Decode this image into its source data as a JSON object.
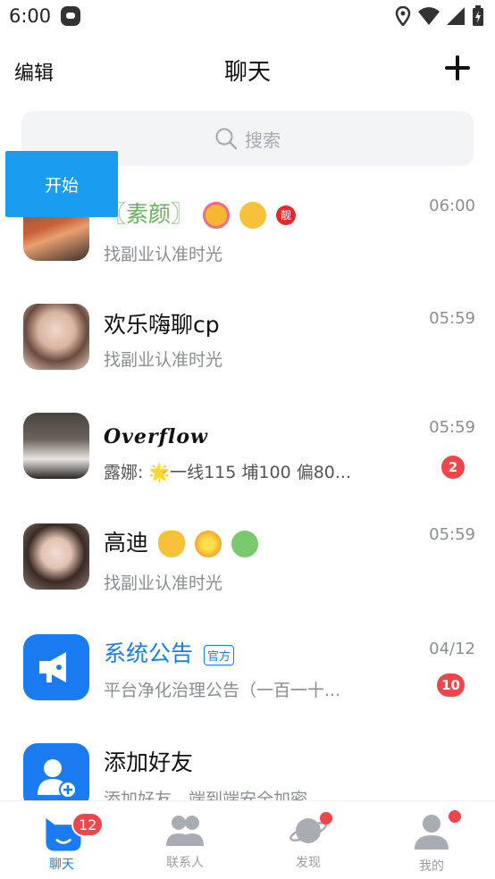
{
  "status_bar": {
    "time": "6:00",
    "icons": [
      "android-app-icon",
      "location-icon",
      "wifi-icon",
      "signal-icon",
      "battery-icon"
    ]
  },
  "header": {
    "edit_label": "编辑",
    "title": "聊天",
    "add_icon": "plus-icon"
  },
  "search": {
    "placeholder": "搜索",
    "icon": "search-icon"
  },
  "start_button": {
    "label": "开始"
  },
  "chats": [
    {
      "name": "〖素颜〗",
      "emojis": [
        "smiling-face-with-hearts-emoji",
        "zany-face-emoji"
      ],
      "badge": "靓",
      "preview": "找副业认准时光",
      "time": "06:00",
      "unread": ""
    },
    {
      "name": "欢乐嗨聊cp",
      "preview": "找副业认准时光",
      "time": "05:59",
      "unread": ""
    },
    {
      "name": "Overflow",
      "preview": "露娜: 🌟一线115 埔100 偏80...",
      "time": "05:59",
      "unread": "2"
    },
    {
      "name": "高迪",
      "emojis": [
        "waving-hand-emoji",
        "sparkle-emoji",
        "nauseated-face-emoji"
      ],
      "preview": "找副业认准时光",
      "time": "05:59",
      "unread": ""
    },
    {
      "name": "系统公告",
      "tag": "官方",
      "preview": "平台净化治理公告（一百一十...",
      "time": "04/12",
      "unread": "10"
    },
    {
      "name": "添加好友",
      "preview": "添加好友，端到端安全加密",
      "time": "",
      "unread": ""
    }
  ],
  "colors": {
    "accent_blue": "#1a7cf0",
    "badge_red": "#f0464b",
    "start_button": "#1a9cf0",
    "green_name": "#6ab05e"
  },
  "bottom_nav": {
    "items": [
      {
        "label": "聊天",
        "icon": "chat-cat-icon",
        "badge": "12",
        "active": true
      },
      {
        "label": "联系人",
        "icon": "contacts-icon",
        "badge": "",
        "active": false
      },
      {
        "label": "发现",
        "icon": "planet-icon",
        "badge": "dot",
        "active": false
      },
      {
        "label": "我的",
        "icon": "profile-icon",
        "badge": "dot",
        "active": false
      }
    ]
  }
}
